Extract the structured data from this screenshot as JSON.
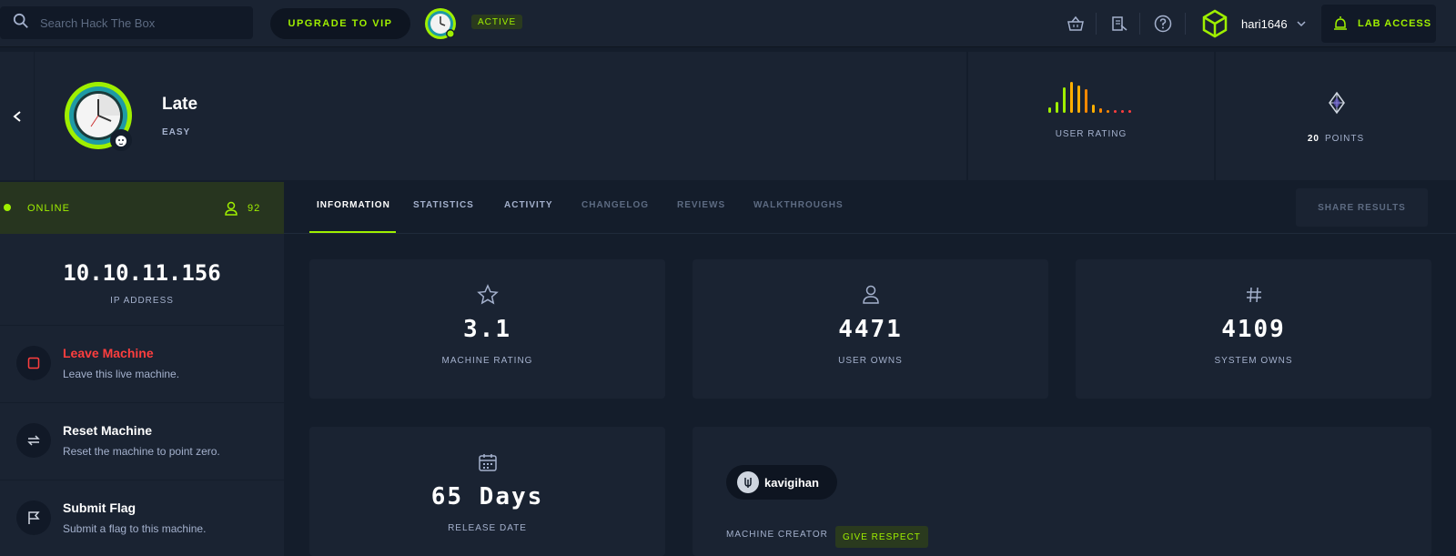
{
  "search": {
    "placeholder": "Search Hack The Box"
  },
  "topbar": {
    "vip_label": "UPGRADE TO VIP",
    "active_label": "ACTIVE",
    "username": "hari1646",
    "lab_access_label": "LAB ACCESS"
  },
  "machine": {
    "name": "Late",
    "difficulty": "EASY",
    "user_rating_label": "USER RATING",
    "points_value": "20",
    "points_label": "POINTS"
  },
  "status": {
    "state": "ONLINE",
    "players": "92"
  },
  "ip": {
    "value": "10.10.11.156",
    "label": "IP ADDRESS"
  },
  "actions": [
    {
      "title": "Leave Machine",
      "subtitle": "Leave this live machine."
    },
    {
      "title": "Reset Machine",
      "subtitle": "Reset the machine to point zero."
    },
    {
      "title": "Submit Flag",
      "subtitle": "Submit a flag to this machine."
    }
  ],
  "tabs": [
    {
      "label": "INFORMATION"
    },
    {
      "label": "STATISTICS"
    },
    {
      "label": "ACTIVITY"
    },
    {
      "label": "CHANGELOG"
    },
    {
      "label": "REVIEWS"
    },
    {
      "label": "WALKTHROUGHS"
    }
  ],
  "share_label": "SHARE RESULTS",
  "stats": [
    {
      "value": "3.1",
      "label": "MACHINE RATING"
    },
    {
      "value": "4471",
      "label": "USER OWNS"
    },
    {
      "value": "4109",
      "label": "SYSTEM OWNS"
    },
    {
      "value": "65 Days",
      "label": "RELEASE DATE"
    }
  ],
  "creator": {
    "name": "kavigihan",
    "label": "MACHINE CREATOR",
    "respect_label": "GIVE RESPECT"
  },
  "colors": {
    "accent": "#9fef00",
    "danger": "#ff3e3e",
    "background": "#141d2b",
    "panel": "#1a2332"
  }
}
